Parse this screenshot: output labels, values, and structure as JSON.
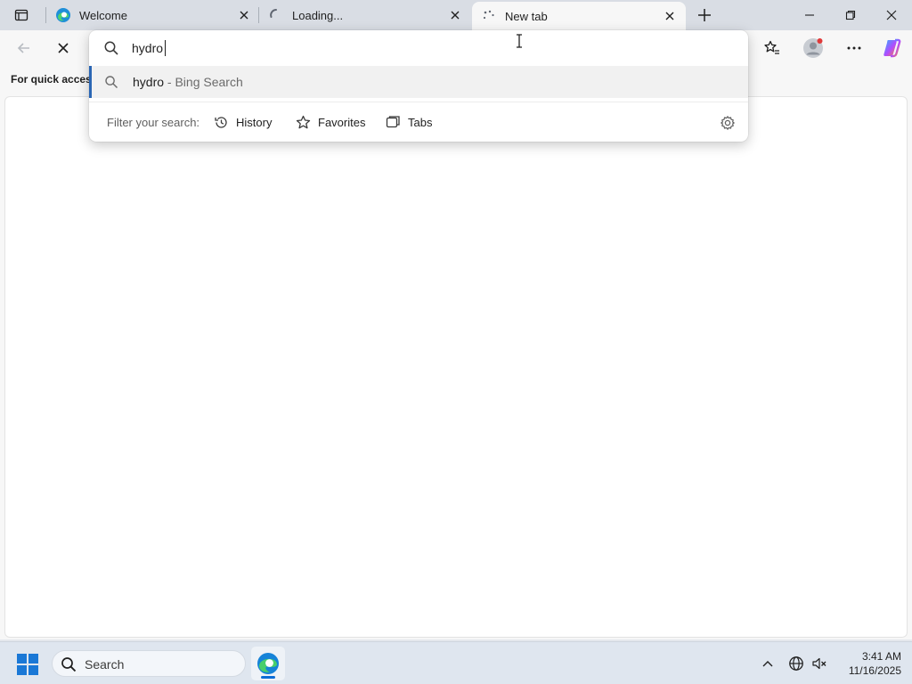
{
  "tabs": [
    {
      "title": "Welcome",
      "state": "normal",
      "favicon": "edge-logo-icon"
    },
    {
      "title": "Loading...",
      "state": "loading",
      "favicon": "spinner-icon"
    },
    {
      "title": "New tab",
      "state": "active",
      "favicon": "loading-dots-icon"
    }
  ],
  "toolbar": {
    "back": "back-arrow-icon",
    "stop": "stop-x-icon"
  },
  "favorites_bar": {
    "label": "For quick access"
  },
  "omnibox": {
    "query": "hydro",
    "suggestion": {
      "term": "hydro",
      "source": "- Bing Search"
    },
    "filter_label": "Filter your search:",
    "filters": [
      {
        "label": "History",
        "icon": "history-icon"
      },
      {
        "label": "Favorites",
        "icon": "star-icon"
      },
      {
        "label": "Tabs",
        "icon": "tabs-icon"
      }
    ]
  },
  "taskbar": {
    "search_label": "Search",
    "time": "3:41 AM",
    "date": "11/16/2025"
  },
  "colors": {
    "accent": "#2a66b4",
    "titlebar": "#d9dde4",
    "taskbar": "#dfe6ef",
    "copilot_gradient": [
      "#2fb0ff",
      "#b04cff",
      "#ff7a3c"
    ]
  }
}
